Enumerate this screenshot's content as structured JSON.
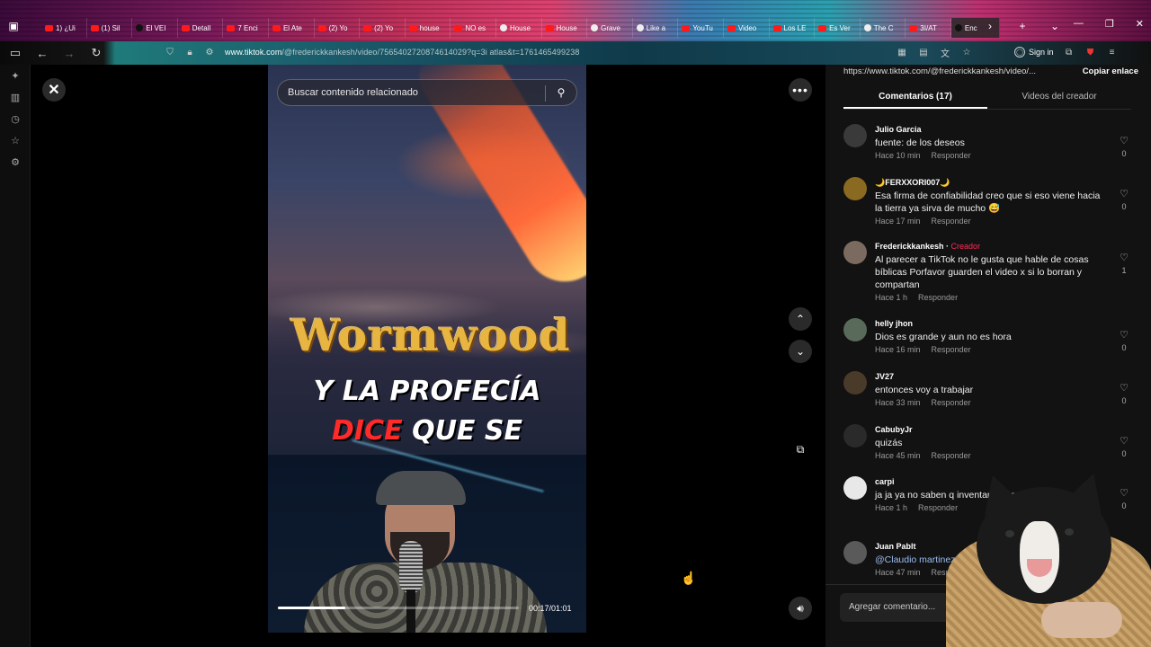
{
  "browser": {
    "tabs": [
      {
        "label": "1) ¿Ui",
        "fav": "yt"
      },
      {
        "label": "(1) Sil",
        "fav": "yt"
      },
      {
        "label": "El VEI",
        "fav": "tk"
      },
      {
        "label": "Detall",
        "fav": "yt"
      },
      {
        "label": "7 Enci",
        "fav": "yt"
      },
      {
        "label": "El Ate",
        "fav": "yt"
      },
      {
        "label": "(2) Yo",
        "fav": "yt"
      },
      {
        "label": "(2) Yo",
        "fav": "yt"
      },
      {
        "label": "house",
        "fav": "yt"
      },
      {
        "label": "NO es",
        "fav": "yt"
      },
      {
        "label": "House",
        "fav": "gl"
      },
      {
        "label": "House",
        "fav": "yt"
      },
      {
        "label": "Grave",
        "fav": "gl"
      },
      {
        "label": "Like a",
        "fav": "gl"
      },
      {
        "label": "YouTu",
        "fav": "yt"
      },
      {
        "label": "Video",
        "fav": "yt"
      },
      {
        "label": "Los LE",
        "fav": "yt"
      },
      {
        "label": "Es Ver",
        "fav": "yt"
      },
      {
        "label": "The C",
        "fav": "gl"
      },
      {
        "label": "3I/AT",
        "fav": "yt"
      },
      {
        "label": "Enc",
        "fav": "tk",
        "active": true
      }
    ],
    "url_domain": "www.tiktok.com",
    "url_path": "/@frederickkankesh/video/7565402720874614029?q=3i atlas&t=1761465499238",
    "signin_label": "Sign in"
  },
  "video": {
    "search_placeholder": "Buscar contenido relacionado",
    "title_art": "Wormwood",
    "caption_line1": "Y LA PROFECÍA",
    "caption_red": "DICE",
    "caption_white": "QUE SE",
    "time": "00:17/01:01",
    "progress": 0.28
  },
  "panel": {
    "share_link": "https://www.tiktok.com/@frederickkankesh/video/...",
    "copy_label": "Copiar enlace",
    "tab_comments": "Comentarios (17)",
    "tab_creator_videos": "Videos del creador",
    "reply_label": "Responder",
    "creator_label": "Creador",
    "add_comment_placeholder": "Agregar comentario...",
    "comments": [
      {
        "user": "Julio Garcia",
        "text": "fuente: de los deseos",
        "time": "Hace 10 min",
        "likes": "0",
        "avatar_color": "#3a3a3a"
      },
      {
        "user": "🌙FERXXORI007🌙",
        "text": "Esa firma de confiabilidad creo que si eso viene hacia la tierra ya sirva de mucho 😅",
        "time": "Hace 17 min",
        "likes": "0",
        "avatar_color": "#8a6a20"
      },
      {
        "user": "Frederickkankesh",
        "creator": true,
        "text": "Al parecer a TikTok no le gusta que hable de cosas bíblicas Porfavor guarden el video x si lo borran y compartan",
        "time": "Hace 1 h",
        "likes": "1",
        "avatar_color": "#7a6a60"
      },
      {
        "user": "helly jhon",
        "text": "Dios es grande y aun no es hora",
        "time": "Hace 16 min",
        "likes": "0",
        "avatar_color": "#5a6a5a"
      },
      {
        "user": "JV27",
        "text": "entonces voy a trabajar",
        "time": "Hace 33 min",
        "likes": "0",
        "avatar_color": "#4a3a2a"
      },
      {
        "user": "CabubyJr",
        "text": "quizás",
        "time": "Hace 45 min",
        "likes": "0",
        "avatar_color": "#2a2a2a"
      },
      {
        "user": "carpi",
        "text": "ja ja ya no saben q inventar federación galáctica n",
        "time": "Hace 1 h",
        "likes": "0",
        "avatar_color": "#e8e8e8"
      },
      {
        "user": "Juan Pablt",
        "text": "@Claudio martinez",
        "mention": true,
        "time": "Hace 47 min",
        "likes": "",
        "avatar_color": "#5a5a5a"
      }
    ]
  }
}
